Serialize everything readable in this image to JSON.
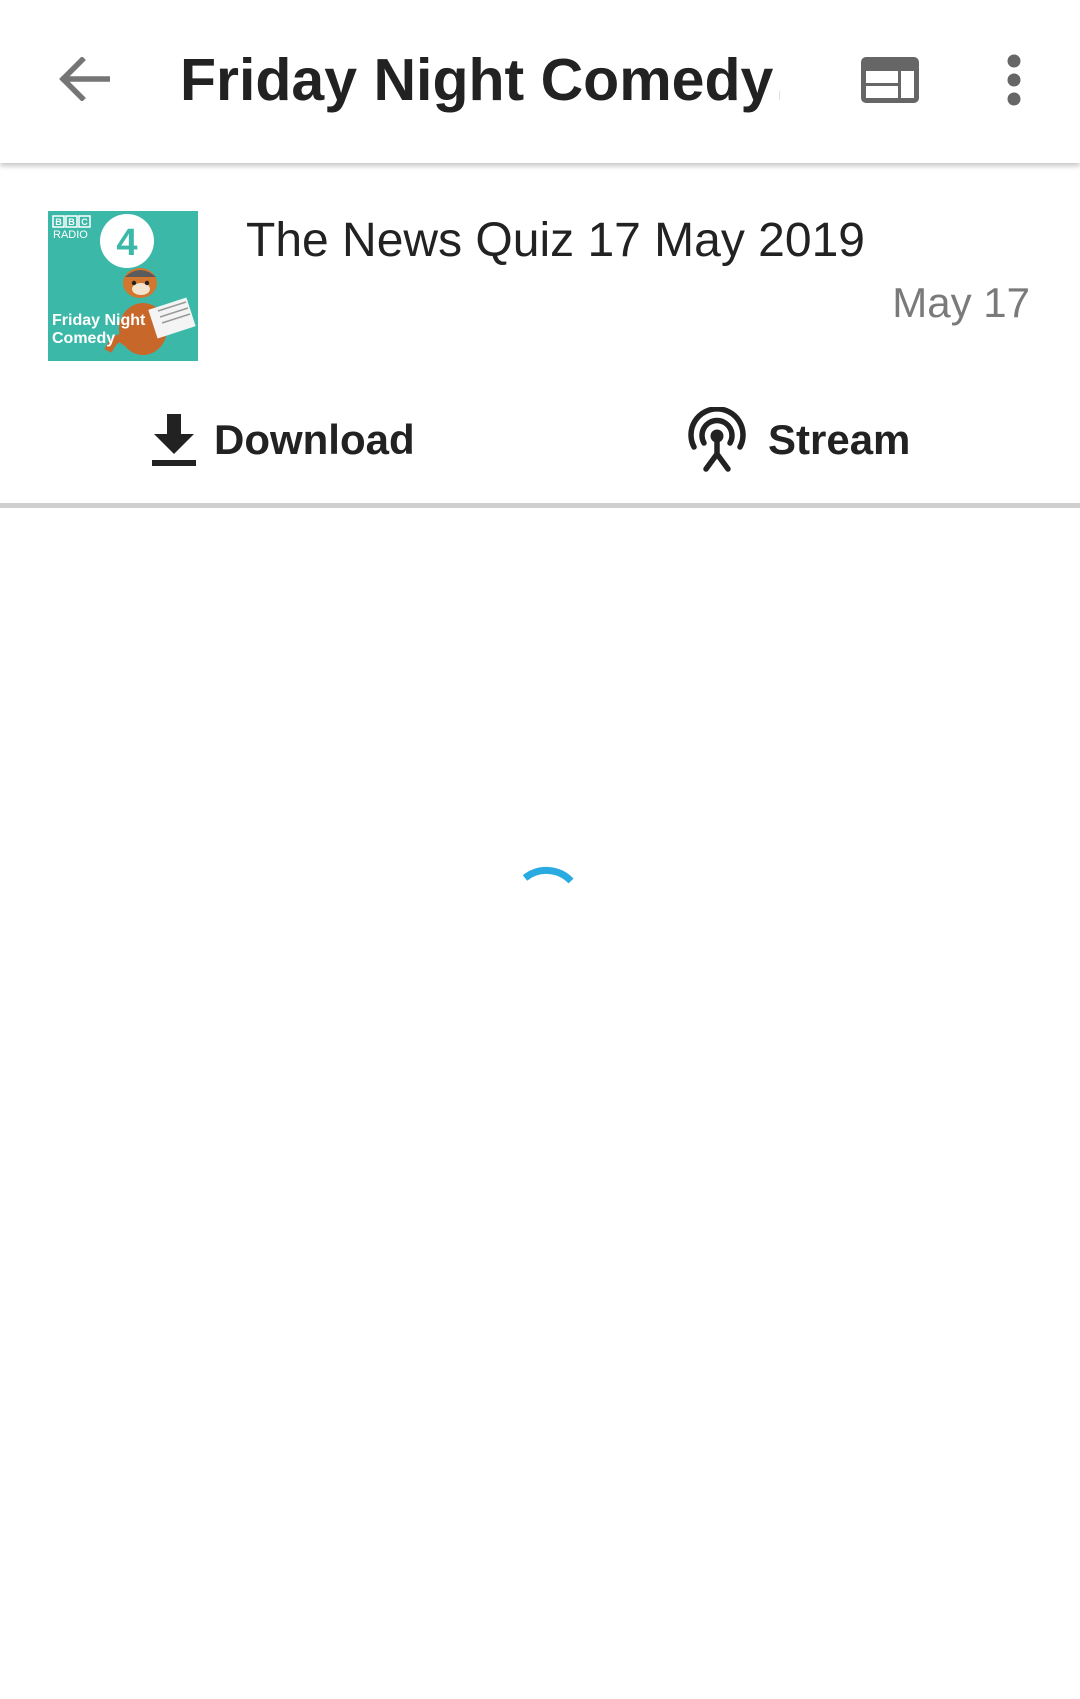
{
  "toolbar": {
    "title": "Friday Night Comedy…",
    "back_icon": "arrow-back-icon",
    "web_icon": "web-view-icon",
    "overflow_icon": "more-vert-icon"
  },
  "episode": {
    "cover": {
      "brand_lines": [
        "BBC",
        "RADIO"
      ],
      "station_number": "4",
      "show_name_lines": [
        "Friday Night",
        "Comedy"
      ]
    },
    "title": "The News Quiz 17 May 2019",
    "date": "May 17",
    "actions": {
      "download_label": "Download",
      "stream_label": "Stream"
    }
  },
  "content": {
    "loading_indicator_color": "#29abe2"
  },
  "colors": {
    "text_primary": "#222222",
    "text_secondary": "#7a7a7a",
    "cover_background": "#3cb8a8",
    "accent": "#29abe2"
  }
}
